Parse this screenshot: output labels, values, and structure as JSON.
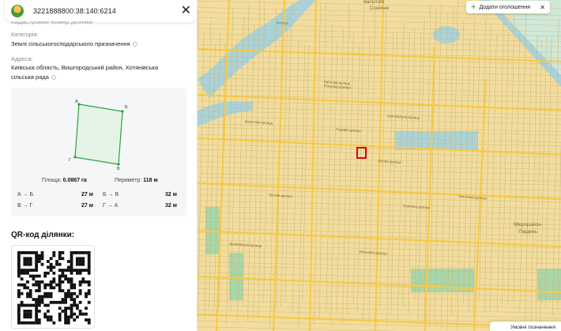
{
  "header": {
    "parcel_id": "3221888800:38:140:6214",
    "close_glyph": "✕",
    "cut_text": "Кадастровий номер ділянки"
  },
  "category": {
    "label": "Категорія:",
    "value": "Землі сільськогосподарського призначення"
  },
  "address": {
    "label": "Адреса:",
    "line1": "Київська область, Вишгородський район, Хотянівська",
    "line2": "сільська рада"
  },
  "shape": {
    "vertex_a": "А",
    "vertex_b": "Б",
    "vertex_v": "В",
    "vertex_g": "Г",
    "stroke_color": "#2e9e3f",
    "fill_color": "#e6f4e8"
  },
  "metrics": {
    "area_label": "Площа:",
    "area_value": "0.0867 га",
    "perimeter_label": "Периметр:",
    "perimeter_value": "118 м"
  },
  "sides": [
    {
      "name": "А → Б",
      "value": "27 м"
    },
    {
      "name": "Б → В",
      "value": "32 м"
    },
    {
      "name": "В → Г",
      "value": "27 м"
    },
    {
      "name": "Г → А",
      "value": "32 м"
    }
  ],
  "qr": {
    "title": "QR-код ділянки:"
  },
  "map": {
    "add_button_label": "Додати оголошення",
    "add_button_icon": "plus-icon",
    "dismiss_glyph": "✕",
    "legend_button_label": "Умовні позначення",
    "streets": [
      "вулиця",
      "Польова вулиця",
      "Садова вулиця",
      "Центральна вулиця",
      "Лісова вулиця",
      "Берегова вулиця",
      "Сонячна вулиця",
      "Дніпровська вулиця",
      "Вишнева вулиця",
      "Квіткова вулиця",
      "Тополина вулиця",
      "Лугова вулиця"
    ],
    "place_top": "масштабі",
    "place_top2": "Сонячне",
    "place_right": "Мікрорайон",
    "place_right2": "Південь",
    "marker_color": "#d0021b",
    "lot_fill": "#f3dfa3",
    "road_color": "#f7c948",
    "water_color": "#a9d3d9",
    "green_color": "#a7d7a9"
  }
}
